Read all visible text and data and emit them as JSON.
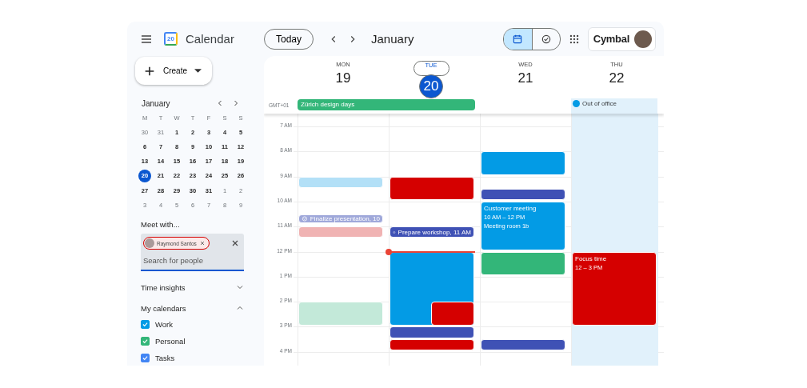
{
  "header": {
    "logo_text": "20",
    "app_name": "Calendar",
    "today_button": "Today",
    "month": "January",
    "view_toggle": [
      {
        "kind": "calendar",
        "selected": true
      },
      {
        "kind": "tasks",
        "selected": false
      }
    ],
    "account": "Cymbal"
  },
  "create_button": "Create",
  "mini_calendar": {
    "month": "January",
    "weekdays": [
      "M",
      "T",
      "W",
      "T",
      "F",
      "S",
      "S"
    ],
    "weeks": [
      [
        {
          "day": "30",
          "muted": true,
          "selected": false
        },
        {
          "day": "31",
          "muted": true,
          "selected": false
        },
        {
          "day": "1",
          "muted": false,
          "selected": false
        },
        {
          "day": "2",
          "muted": false,
          "selected": false
        },
        {
          "day": "3",
          "muted": false,
          "selected": false
        },
        {
          "day": "4",
          "muted": false,
          "selected": false
        },
        {
          "day": "5",
          "muted": false,
          "selected": false
        }
      ],
      [
        {
          "day": "6",
          "muted": false,
          "selected": false
        },
        {
          "day": "7",
          "muted": false,
          "selected": false
        },
        {
          "day": "8",
          "muted": false,
          "selected": false
        },
        {
          "day": "9",
          "muted": false,
          "selected": false
        },
        {
          "day": "10",
          "muted": false,
          "selected": false
        },
        {
          "day": "11",
          "muted": false,
          "selected": false
        },
        {
          "day": "12",
          "muted": false,
          "selected": false
        }
      ],
      [
        {
          "day": "13",
          "muted": false,
          "selected": false
        },
        {
          "day": "14",
          "muted": false,
          "selected": false
        },
        {
          "day": "15",
          "muted": false,
          "selected": false
        },
        {
          "day": "16",
          "muted": false,
          "selected": false
        },
        {
          "day": "17",
          "muted": false,
          "selected": false
        },
        {
          "day": "18",
          "muted": false,
          "selected": false
        },
        {
          "day": "19",
          "muted": false,
          "selected": false
        }
      ],
      [
        {
          "day": "20",
          "muted": false,
          "selected": true
        },
        {
          "day": "21",
          "muted": false,
          "selected": false
        },
        {
          "day": "22",
          "muted": false,
          "selected": false
        },
        {
          "day": "23",
          "muted": false,
          "selected": false
        },
        {
          "day": "24",
          "muted": false,
          "selected": false
        },
        {
          "day": "25",
          "muted": false,
          "selected": false
        },
        {
          "day": "26",
          "muted": false,
          "selected": false
        }
      ],
      [
        {
          "day": "27",
          "muted": false,
          "selected": false
        },
        {
          "day": "28",
          "muted": false,
          "selected": false
        },
        {
          "day": "29",
          "muted": false,
          "selected": false
        },
        {
          "day": "30",
          "muted": false,
          "selected": false
        },
        {
          "day": "31",
          "muted": false,
          "selected": false
        },
        {
          "day": "1",
          "muted": true,
          "selected": false
        },
        {
          "day": "2",
          "muted": true,
          "selected": false
        }
      ],
      [
        {
          "day": "3",
          "muted": true,
          "selected": false
        },
        {
          "day": "4",
          "muted": true,
          "selected": false
        },
        {
          "day": "5",
          "muted": true,
          "selected": false
        },
        {
          "day": "6",
          "muted": true,
          "selected": false
        },
        {
          "day": "7",
          "muted": true,
          "selected": false
        },
        {
          "day": "8",
          "muted": true,
          "selected": false
        },
        {
          "day": "9",
          "muted": true,
          "selected": false
        }
      ]
    ]
  },
  "meet_with": {
    "title": "Meet with...",
    "chips": [
      {
        "name": "Raymond Santos",
        "highlighted": true
      }
    ],
    "placeholder": "Search for people"
  },
  "sections": [
    {
      "title": "Time insights",
      "expanded": false
    },
    {
      "title": "My calendars",
      "expanded": true
    }
  ],
  "calendars": [
    {
      "name": "Work",
      "checked": true,
      "color": "#039be5"
    },
    {
      "name": "Personal",
      "checked": true,
      "color": "#33b679"
    },
    {
      "name": "Tasks",
      "checked": true,
      "color": "#4285f4"
    }
  ],
  "week": {
    "timezone": "GMT+01",
    "hours": [
      "7 AM",
      "8 AM",
      "9 AM",
      "10 AM",
      "11 AM",
      "12 PM",
      "1 PM",
      "2 PM",
      "3 PM",
      "4 PM"
    ],
    "days": [
      {
        "weekday": "MON",
        "date": "19",
        "today": false,
        "all_day": [
          {
            "title": "Zürich design days",
            "color": "#33b679"
          }
        ],
        "events": [
          {
            "kind": "event",
            "color": "#b3e0f7"
          },
          {
            "kind": "task",
            "title": "Finalize presentation, 10",
            "color": "#9fa8da"
          },
          {
            "kind": "event",
            "color": "#f0b3b3"
          },
          {
            "kind": "event",
            "color": "#c3e9d9"
          }
        ]
      },
      {
        "weekday": "TUE",
        "date": "20",
        "today": true,
        "now_line": true,
        "events": [
          {
            "kind": "event",
            "color": "#d50000"
          },
          {
            "kind": "task",
            "title": "Prepare workshop, 11 AM",
            "color": "#3f51b5"
          },
          {
            "kind": "event",
            "color": "#039be5"
          },
          {
            "kind": "event",
            "color": "#d50000"
          },
          {
            "kind": "event",
            "color": "#3f51b5"
          },
          {
            "kind": "event",
            "color": "#d50000"
          }
        ]
      },
      {
        "weekday": "WED",
        "date": "21",
        "today": false,
        "events": [
          {
            "kind": "event",
            "color": "#039be5"
          },
          {
            "kind": "event",
            "color": "#3f51b5"
          },
          {
            "kind": "event",
            "title": "Customer meeting",
            "time": "10 AM – 12 PM",
            "location": "Meeting room 1b",
            "color": "#039be5"
          },
          {
            "kind": "event",
            "color": "#33b679"
          },
          {
            "kind": "event",
            "color": "#3f51b5"
          }
        ]
      },
      {
        "weekday": "THU",
        "date": "22",
        "today": false,
        "out_of_office": {
          "title": "Out of office",
          "color": "#039be5"
        },
        "events": [
          {
            "kind": "event",
            "title": "Focus time",
            "time": "12 – 3 PM",
            "color": "#d50000"
          }
        ]
      }
    ]
  }
}
